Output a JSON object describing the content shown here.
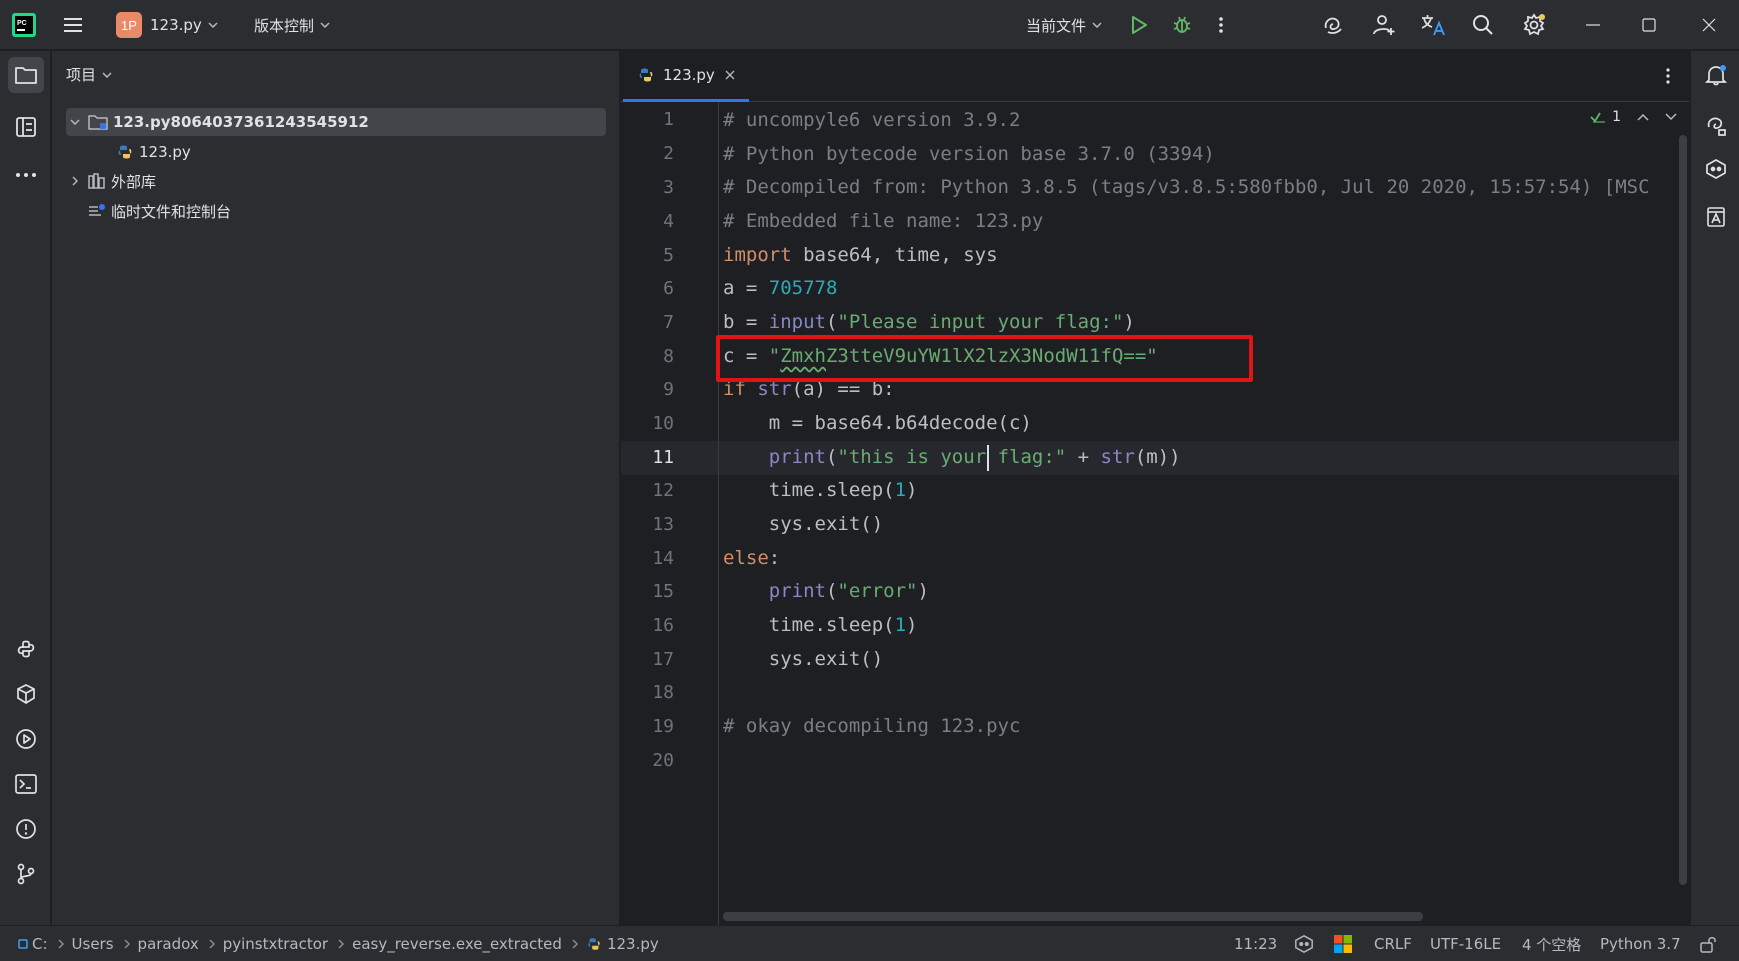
{
  "titlebar": {
    "project_badge": "1P",
    "project_name": "123.py",
    "vcs_menu": "版本控制",
    "run_config": "当前文件",
    "icons": [
      "pycharm-logo-icon",
      "hamburger-menu-icon",
      "run-icon",
      "debug-icon",
      "more-vertical-icon",
      "ai-assistant-icon",
      "add-user-icon",
      "translate-icon",
      "search-icon",
      "settings-icon",
      "minimize-icon",
      "maximize-icon",
      "close-icon"
    ]
  },
  "project_panel": {
    "title": "项目",
    "tree": [
      {
        "label": "123.py8064037361243545912",
        "kind": "folder",
        "expanded": true,
        "selected": true
      },
      {
        "label": "123.py",
        "kind": "python-file"
      },
      {
        "label": "外部库",
        "kind": "library",
        "expanded": false
      },
      {
        "label": "临时文件和控制台",
        "kind": "scratches"
      }
    ]
  },
  "editor": {
    "tab_label": "123.py",
    "inspection_count": "1",
    "current_line": 11,
    "line_numbers": [
      "1",
      "2",
      "3",
      "4",
      "5",
      "6",
      "7",
      "8",
      "9",
      "10",
      "11",
      "12",
      "13",
      "14",
      "15",
      "16",
      "17",
      "18",
      "19",
      "20"
    ],
    "lines": {
      "l1": "# uncompyle6 version 3.9.2",
      "l2": "# Python bytecode version base 3.7.0 (3394)",
      "l3": "# Decompiled from: Python 3.8.5 (tags/v3.8.5:580fbb0, Jul 20 2020, 15:57:54) [MSC",
      "l4": "# Embedded file name: 123.py",
      "l5_kw": "import",
      "l5_rest": " base64, time, sys",
      "l6_pre": "a = ",
      "l6_num": "705778",
      "l7_pre": "b = ",
      "l7_fn": "input",
      "l7_open": "(",
      "l7_str": "\"Please input your flag:\"",
      "l7_close": ")",
      "l8_pre": "c = ",
      "l8_q1": "\"",
      "l8_typo": "Zmxh",
      "l8_str_rest": "Z3tteV9uYW1lX2lzX3NodW11fQ==\"",
      "l9_kw": "if",
      "l9_sp": " ",
      "l9_fn": "str",
      "l9_rest": "(a) == b:",
      "l10": "    m = base64.b64decode(c)",
      "l11_ind": "    ",
      "l11_fn": "print",
      "l11_open": "(",
      "l11_str": "\"this is your flag:\"",
      "l11_plus": " + ",
      "l11_fn2": "str",
      "l11_end": "(m))",
      "l12_pre": "    time.sleep(",
      "l12_num": "1",
      "l12_end": ")",
      "l13": "    sys.exit()",
      "l14_kw": "else",
      "l14_end": ":",
      "l15_ind": "    ",
      "l15_fn": "print",
      "l15_open": "(",
      "l15_str": "\"error\"",
      "l15_close": ")",
      "l16_pre": "    time.sleep(",
      "l16_num": "1",
      "l16_end": ")",
      "l17": "    sys.exit()",
      "l18": "",
      "l19": "# okay decompiling 123.pyc",
      "l20": ""
    },
    "colors": {
      "comment": "#7a7e85",
      "keyword": "#cf8e6d",
      "number": "#2aacb8",
      "string": "#6aab73",
      "builtin": "#8888c6",
      "highlight_box": "#e01414"
    }
  },
  "statusbar": {
    "breadcrumbs": [
      "C:",
      "Users",
      "paradox",
      "pyinstxtractor",
      "easy_reverse.exe_extracted",
      "123.py"
    ],
    "position": "11:23",
    "line_separator": "CRLF",
    "encoding": "UTF-16LE",
    "indent": "4 个空格",
    "interpreter": "Python 3.7"
  }
}
